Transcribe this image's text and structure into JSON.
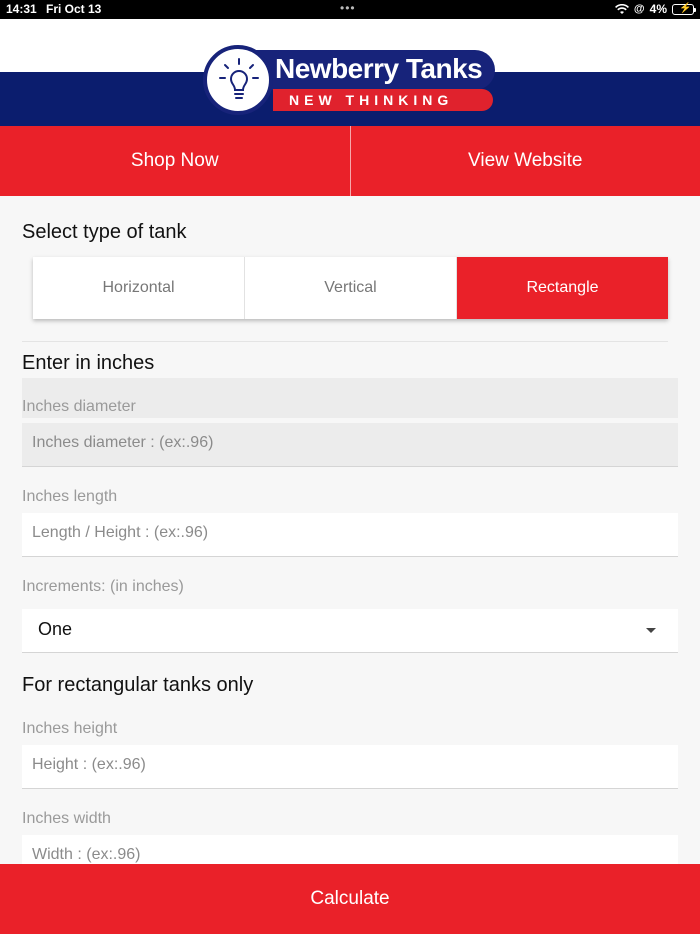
{
  "status_bar": {
    "time": "14:31",
    "date": "Fri Oct 13",
    "battery": "4%"
  },
  "logo": {
    "brand": "Newberry Tanks",
    "tagline": "NEW THINKING"
  },
  "top_buttons": {
    "shop_label": "Shop Now",
    "website_label": "View Website"
  },
  "tank_type": {
    "title": "Select type of tank",
    "options": [
      "Horizontal",
      "Vertical",
      "Rectangle"
    ],
    "selected": "Rectangle"
  },
  "inches": {
    "title": "Enter in inches",
    "diameter_label": "Inches diameter",
    "diameter_placeholder": "Inches diameter : (ex:.96)",
    "length_label": "Inches length",
    "length_placeholder": "Length / Height : (ex:.96)",
    "increments_label": "Increments: (in inches)",
    "increments_value": "One"
  },
  "rectangular": {
    "title": "For rectangular tanks only",
    "height_label": "Inches height",
    "height_placeholder": "Height : (ex:.96)",
    "width_label": "Inches width",
    "width_placeholder": "Width : (ex:.96)"
  },
  "calculate_label": "Calculate",
  "colors": {
    "brand_red": "#ea2129",
    "brand_navy": "#0b1d6e"
  }
}
